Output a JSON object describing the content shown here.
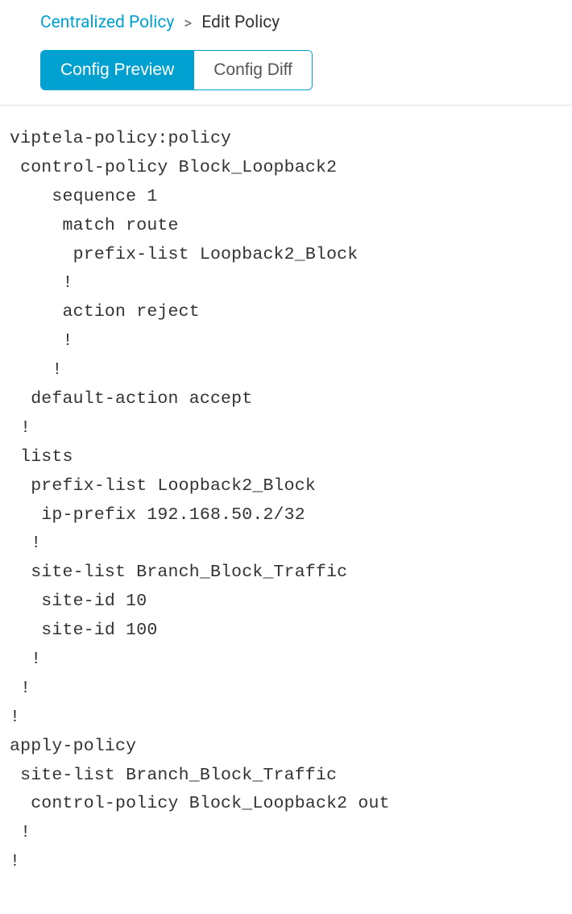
{
  "breadcrumb": {
    "link_label": "Centralized Policy",
    "separator": ">",
    "current_label": "Edit Policy"
  },
  "tabs": {
    "preview_label": "Config Preview",
    "diff_label": "Config Diff"
  },
  "config_text": "viptela-policy:policy\n control-policy Block_Loopback2\n    sequence 1\n     match route\n      prefix-list Loopback2_Block\n     !\n     action reject\n     !\n    !\n  default-action accept\n !\n lists\n  prefix-list Loopback2_Block\n   ip-prefix 192.168.50.2/32\n  !\n  site-list Branch_Block_Traffic\n   site-id 10\n   site-id 100\n  !\n !\n!\napply-policy\n site-list Branch_Block_Traffic\n  control-policy Block_Loopback2 out\n !\n!"
}
